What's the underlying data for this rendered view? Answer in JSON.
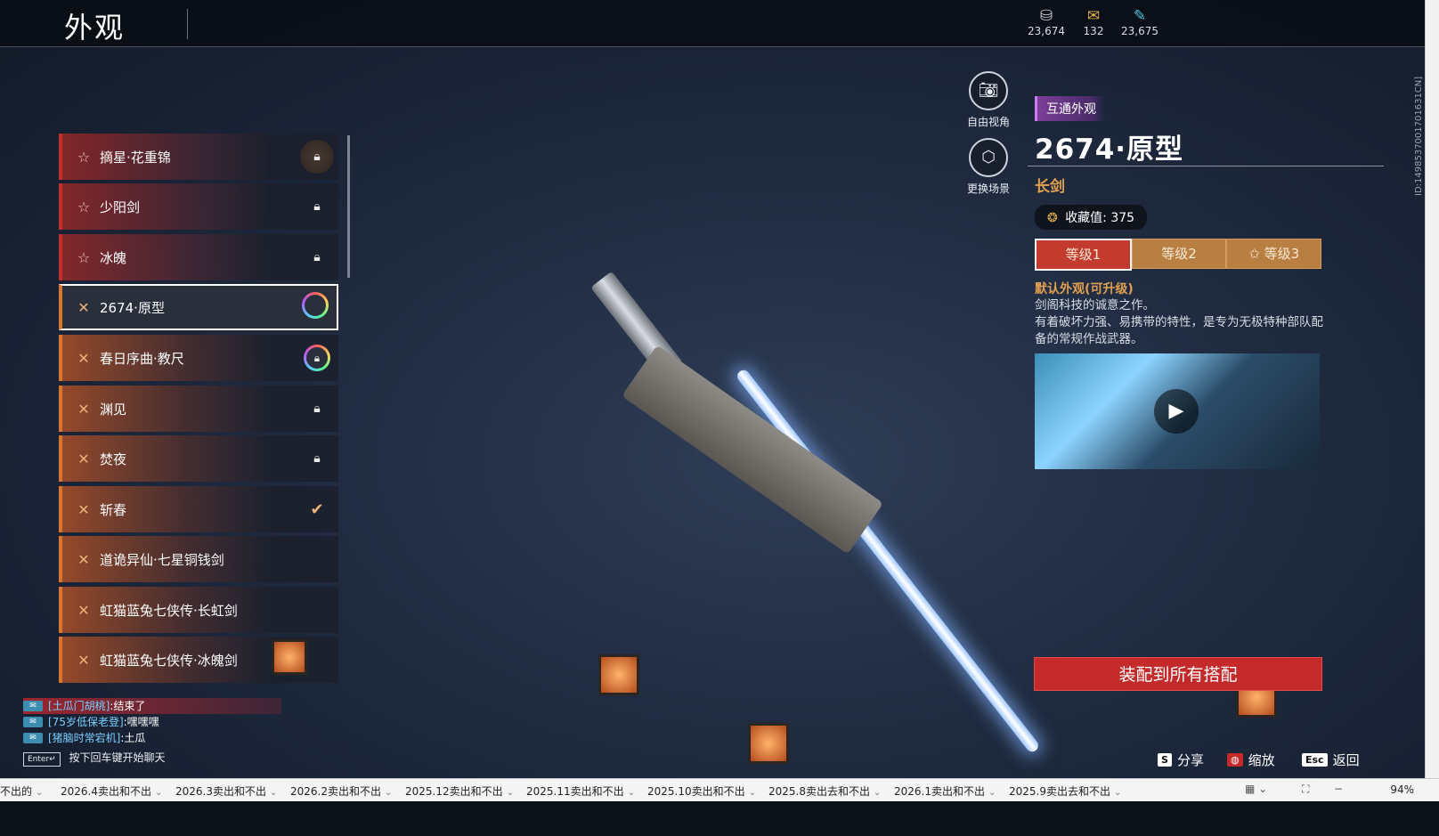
{
  "header": {
    "title": "外观",
    "currencies": [
      {
        "icon": "coin-icon",
        "value": "23,674"
      },
      {
        "icon": "ticket-icon",
        "value": "132"
      },
      {
        "icon": "feather-icon",
        "value": "23,675"
      }
    ],
    "id_text": "ID:1498537001701631CN]"
  },
  "list": {
    "items": [
      {
        "name": "摘星·花重锦",
        "tier": "red",
        "status": "lock"
      },
      {
        "name": "少阳剑",
        "tier": "red",
        "status": "lock"
      },
      {
        "name": "冰魄",
        "tier": "red",
        "status": "lock"
      },
      {
        "name": "2674·原型",
        "tier": "orange",
        "status": "ring",
        "selected": true
      },
      {
        "name": "春日序曲·教尺",
        "tier": "orange",
        "status": "ring-lock"
      },
      {
        "name": "渊见",
        "tier": "orange",
        "status": "lock"
      },
      {
        "name": "焚夜",
        "tier": "orange",
        "status": "lock"
      },
      {
        "name": "斩春",
        "tier": "orange",
        "status": "check"
      },
      {
        "name": "道诡异仙·七星铜钱剑",
        "tier": "orange",
        "status": ""
      },
      {
        "name": "虹猫蓝兔七侠传·长虹剑",
        "tier": "orange",
        "status": ""
      },
      {
        "name": "虹猫蓝兔七侠传·冰魄剑",
        "tier": "orange",
        "status": ""
      }
    ]
  },
  "tools": {
    "free_view": "自由视角",
    "change_scene": "更换场景"
  },
  "detail": {
    "tag": "互通外观",
    "title": "2674·原型",
    "type": "长剑",
    "collect_label": "收藏值: 375",
    "levels": [
      "等级1",
      "等级2",
      "等级3"
    ],
    "active_level": 0,
    "desc_title": "默认外观(可升级)",
    "desc_line1": "剑阁科技的诚意之作。",
    "desc_line2": "有着破坏力强、易携带的特性，是专为无极特种部队配备的常规作战武器。",
    "equip_button": "装配到所有搭配"
  },
  "chat": {
    "lines": [
      {
        "user": "[土瓜门胡桃]",
        "text": ":结束了"
      },
      {
        "user": "[75岁低保老登]",
        "text": ":嘿嘿嘿"
      },
      {
        "user": "[猪脑时常宕机]",
        "text": ":土瓜"
      }
    ],
    "hint_key": "Enter↵",
    "hint": "按下回车键开始聊天"
  },
  "footer": {
    "share_key": "S",
    "share": "分享",
    "zoom": "缩放",
    "back_key": "Esc",
    "back": "返回"
  },
  "taskbar": {
    "sheets": [
      "不出的",
      "2026.4卖出和不出",
      "2026.3卖出和不出",
      "2026.2卖出和不出",
      "2025.12卖出和不出",
      "2025.11卖出和不出",
      "2025.10卖出和不出",
      "2025.8卖出去和不出",
      "2026.1卖出和不出",
      "2025.9卖出去和不出"
    ],
    "zoom": "94%"
  }
}
